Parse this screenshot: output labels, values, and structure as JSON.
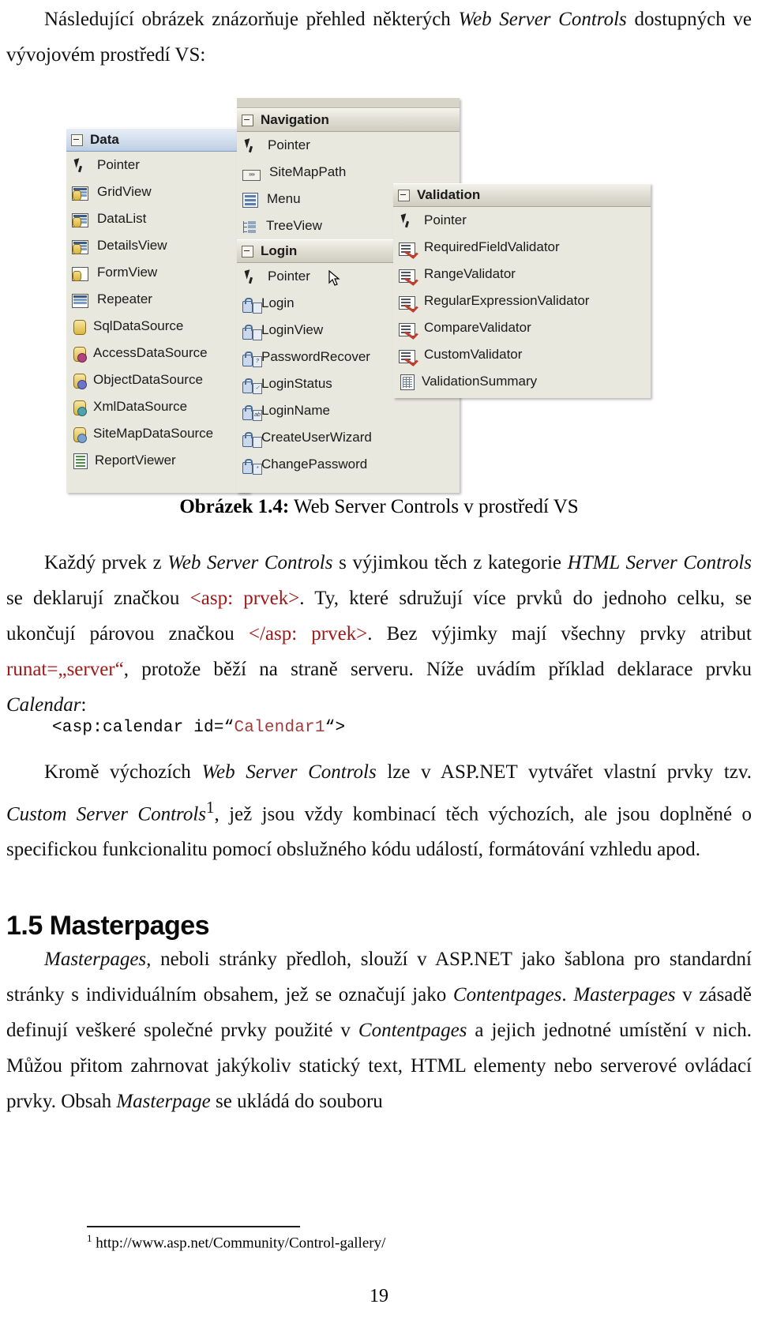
{
  "intro": {
    "text_before_italic": "Následující obrázek znázorňuje přehled některých ",
    "italic_1": "Web Server Controls",
    "text_after": " dostupných ve vývojovém prostředí VS:"
  },
  "figure": {
    "caption_label": "Obrázek 1.4:",
    "caption_text": " Web Server Controls v prostředí VS",
    "toolbox": {
      "panels": [
        {
          "name": "Data",
          "header": "Data",
          "selected": true,
          "items": [
            {
              "label": "Pointer",
              "icon": "pointer-icon"
            },
            {
              "label": "GridView",
              "icon": "gridview-icon"
            },
            {
              "label": "DataList",
              "icon": "datalist-icon"
            },
            {
              "label": "DetailsView",
              "icon": "detailsview-icon"
            },
            {
              "label": "FormView",
              "icon": "formview-icon"
            },
            {
              "label": "Repeater",
              "icon": "repeater-icon"
            },
            {
              "label": "SqlDataSource",
              "icon": "sqldatasource-icon"
            },
            {
              "label": "AccessDataSource",
              "icon": "accessdatasource-icon"
            },
            {
              "label": "ObjectDataSource",
              "icon": "objectdatasource-icon"
            },
            {
              "label": "XmlDataSource",
              "icon": "xmldatasource-icon"
            },
            {
              "label": "SiteMapDataSource",
              "icon": "sitemapdatasource-icon"
            },
            {
              "label": "ReportViewer",
              "icon": "reportviewer-icon"
            }
          ]
        },
        {
          "name": "Navigation",
          "header": "Navigation",
          "selected": false,
          "items": [
            {
              "label": "Pointer",
              "icon": "pointer-icon"
            },
            {
              "label": "SiteMapPath",
              "icon": "sitemappath-icon"
            },
            {
              "label": "Menu",
              "icon": "menu-icon"
            },
            {
              "label": "TreeView",
              "icon": "treeview-icon"
            }
          ]
        },
        {
          "name": "Login",
          "header": "Login",
          "selected": false,
          "items": [
            {
              "label": "Pointer",
              "icon": "pointer-icon"
            },
            {
              "label": "Login",
              "icon": "login-icon"
            },
            {
              "label": "LoginView",
              "icon": "loginview-icon"
            },
            {
              "label": "PasswordRecover",
              "icon": "passwordrecovery-icon"
            },
            {
              "label": "LoginStatus",
              "icon": "loginstatus-icon"
            },
            {
              "label": "LoginName",
              "icon": "loginname-icon"
            },
            {
              "label": "CreateUserWizard",
              "icon": "createuserwizard-icon"
            },
            {
              "label": "ChangePassword",
              "icon": "changepassword-icon"
            }
          ]
        },
        {
          "name": "Validation",
          "header": "Validation",
          "selected": false,
          "items": [
            {
              "label": "Pointer",
              "icon": "pointer-icon"
            },
            {
              "label": "RequiredFieldValidator",
              "icon": "requiredfieldvalidator-icon"
            },
            {
              "label": "RangeValidator",
              "icon": "rangevalidator-icon"
            },
            {
              "label": "RegularExpressionValidator",
              "icon": "regularexpressionvalidator-icon"
            },
            {
              "label": "CompareValidator",
              "icon": "comparevalidator-icon"
            },
            {
              "label": "CustomValidator",
              "icon": "customvalidator-icon"
            },
            {
              "label": "ValidationSummary",
              "icon": "validationsummary-icon"
            }
          ]
        }
      ]
    }
  },
  "body": {
    "p1": {
      "s1": "Každý prvek z ",
      "i1": "Web Server Controls",
      "s2": " s výjimkou těch z kategorie ",
      "i2": "HTML Server Controls",
      "s3": " se deklarují značkou ",
      "code1": "<asp: prvek>",
      "s4": ". Ty, které sdružují více prvků do jednoho celku, se ukončují párovou značkou ",
      "code2": "</asp: prvek>",
      "s5": ". Bez výjimky mají všechny prvky atribut ",
      "code3": "runat=„server“",
      "s6": ", protože běží na straně serveru. Níže uvádím příklad deklarace prvku ",
      "i3": "Calendar",
      "s7": ":"
    },
    "code_sample": {
      "prefix": "<asp:calendar id=“",
      "identifier": "Calendar1",
      "suffix": "“>"
    },
    "p2": {
      "s1": "Kromě výchozích ",
      "i1": "Web Server Controls",
      "s2": " lze v ASP.NET vytvářet vlastní prvky tzv. ",
      "i2": "Custom Server Controls",
      "sup": "1",
      "s3": ", jež jsou vždy kombinací těch výchozích, ale jsou doplněné o specifickou funkcionalitu pomocí obslužného kódu událostí, formátování vzhledu apod."
    },
    "heading_15": "1.5 Masterpages",
    "p3": {
      "i1": "Masterpages,",
      "s1": " neboli stránky předloh, slouží v ASP.NET jako šablona pro standardní stránky s individuálním obsahem, jež se označují jako ",
      "i2": "Contentpages",
      "s2": ". ",
      "i3": "Masterpages",
      "s3": " v zásadě definují veškeré společné prvky použité v ",
      "i4": "Contentpages",
      "s4": " a jejich jednotné umístění v nich. Můžou přitom zahrnovat jakýkoliv statický text, HTML elementy nebo serverové ovládací prvky. Obsah ",
      "i5": "Masterpage",
      "s5": " se ukládá do souboru"
    }
  },
  "footnote": {
    "marker": "1",
    "text": " http://www.asp.net/Community/Control-gallery/"
  },
  "page_number": "19"
}
